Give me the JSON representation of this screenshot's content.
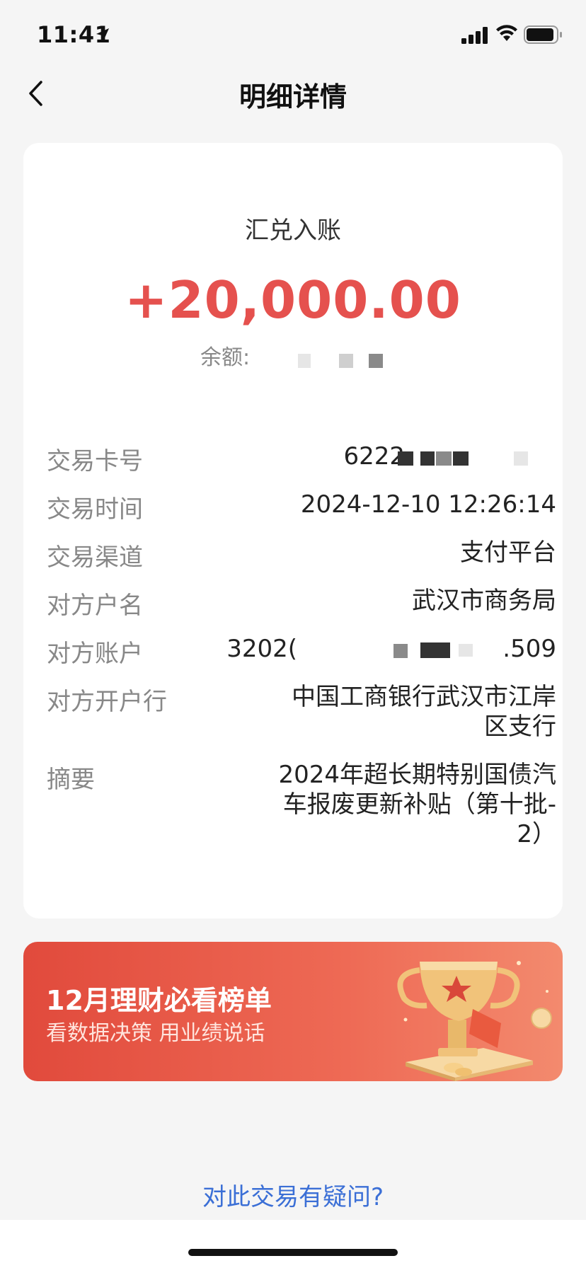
{
  "status_bar": {
    "time": "11:41"
  },
  "nav": {
    "title": "明细详情"
  },
  "transaction": {
    "type": "汇兑入账",
    "amount": "+20,000.00",
    "balance_label": "余额:",
    "amount_color": "#e5514e"
  },
  "details": [
    {
      "label": "交易卡号",
      "value": "6222"
    },
    {
      "label": "交易时间",
      "value": "2024-12-10 12:26:14"
    },
    {
      "label": "交易渠道",
      "value": "支付平台"
    },
    {
      "label": "对方户名",
      "value": "武汉市商务局"
    },
    {
      "label": "对方账户",
      "value_prefix": "3202(",
      "value_suffix": ".509"
    },
    {
      "label": "对方开户行",
      "value_line1": "中国工商银行武汉市江岸",
      "value_line2": "区支行"
    },
    {
      "label": "摘要",
      "value_line1": "2024年超长期特别国债汽",
      "value_line2": "车报废更新补贴（第十批-",
      "value_line3": "2）"
    }
  ],
  "promo": {
    "title": "12月理财必看榜单",
    "subtitle": "看数据决策 用业绩说话",
    "accent": "#e14a3c"
  },
  "help": {
    "link": "对此交易有疑问?"
  },
  "icons": [
    "location-arrow-icon",
    "signal-icon",
    "wifi-icon",
    "battery-icon",
    "back-chevron-icon",
    "trophy-icon"
  ]
}
